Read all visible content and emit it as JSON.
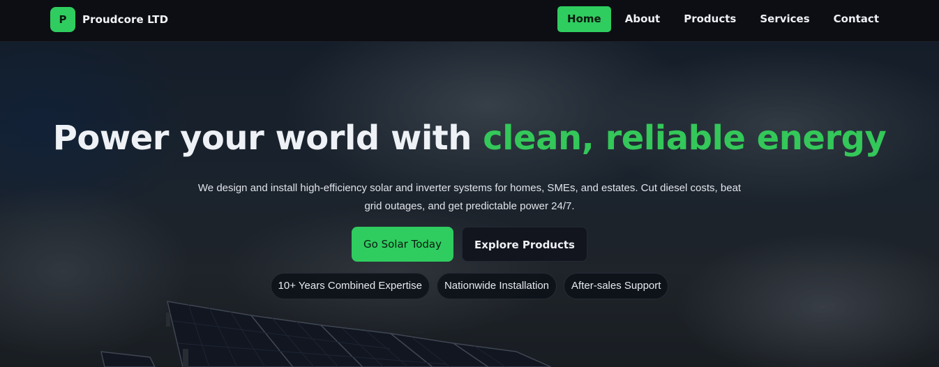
{
  "brand": {
    "logo_letter": "P",
    "name": "Proudcore LTD"
  },
  "nav": {
    "items": [
      {
        "label": "Home",
        "active": true
      },
      {
        "label": "About",
        "active": false
      },
      {
        "label": "Products",
        "active": false
      },
      {
        "label": "Services",
        "active": false
      },
      {
        "label": "Contact",
        "active": false
      }
    ]
  },
  "hero": {
    "title_main": "Power your world with ",
    "title_accent": "clean, reliable energy",
    "subtitle": "We design and install high-efficiency solar and inverter systems for homes, SMEs, and estates. Cut diesel costs, beat grid outages, and get predictable power 24/7.",
    "cta_primary": "Go Solar Today",
    "cta_secondary": "Explore Products",
    "badges": [
      "10+ Years Combined Expertise",
      "Nationwide Installation",
      "After-sales Support"
    ]
  },
  "colors": {
    "accent": "#34c759",
    "nav_bg": "#0c0e13",
    "badge_bg": "#0d1118"
  }
}
